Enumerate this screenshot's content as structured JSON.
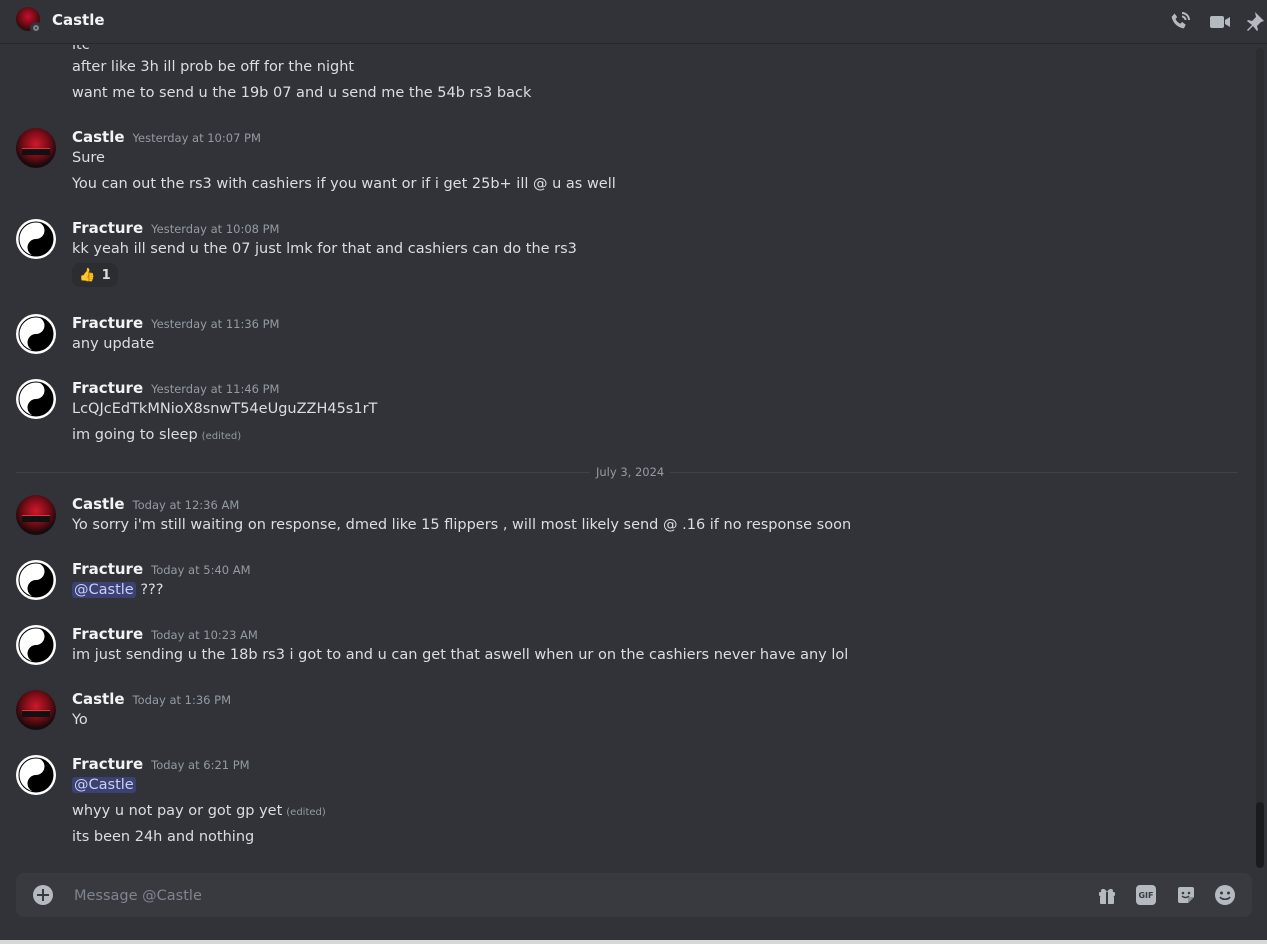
{
  "header": {
    "title": "Castle"
  },
  "messages_prelude": [
    "ltc",
    "after like 3h ill prob be off for the night",
    "want me to send u the 19b 07 and u send me the 54b rs3 back"
  ],
  "groups": [
    {
      "author": "Castle",
      "time": "Yesterday at 10:07 PM",
      "lines": [
        "Sure",
        "You can out the rs3 with cashiers if you want or if i get 25b+ ill @ u as well"
      ]
    },
    {
      "author": "Fracture",
      "time": "Yesterday at 10:08 PM",
      "lines": [
        "kk yeah ill send u the 07 just lmk for that and cashiers can do the rs3"
      ],
      "reaction": {
        "emoji": "👍",
        "count": "1"
      }
    },
    {
      "author": "Fracture",
      "time": "Yesterday at 11:36 PM",
      "lines": [
        "any update"
      ]
    },
    {
      "author": "Fracture",
      "time": "Yesterday at 11:46 PM",
      "lines": [
        "LcQJcEdTkMNioX8snwT54eUguZZH45s1rT",
        "im going to sleep"
      ],
      "edited": "(edited)"
    },
    {
      "author": "Castle",
      "time": "Today at 12:36 AM",
      "lines": [
        "Yo sorry i'm still waiting on response, dmed like 15 flippers , will most likely send @ .16 if no response soon"
      ]
    },
    {
      "author": "Fracture",
      "time": "Today at 5:40 AM",
      "mention": "@Castle",
      "lines": [
        "???"
      ]
    },
    {
      "author": "Fracture",
      "time": "Today at 10:23 AM",
      "lines": [
        "im just sending u the 18b rs3 i got to and u can get that aswell when ur on the cashiers never have any lol"
      ]
    },
    {
      "author": "Castle",
      "time": "Today at 1:36 PM",
      "lines": [
        "Yo"
      ]
    },
    {
      "author": "Fracture",
      "time": "Today at 6:21 PM",
      "mention": "@Castle",
      "lines": [
        "whyy u not pay or got gp yet",
        "its been 24h and nothing"
      ],
      "edited": "(edited)"
    }
  ],
  "divider": {
    "label": "July 3, 2024"
  },
  "composer": {
    "placeholder": "Message @Castle"
  },
  "icons": {
    "header": [
      "phone-call-icon",
      "video-call-icon",
      "pin-icon"
    ],
    "composer": [
      "add-attachment-icon",
      "gift-icon",
      "gif-icon",
      "sticker-icon",
      "emoji-icon"
    ]
  },
  "colors": {
    "background": "#313338",
    "composer": "#383a40",
    "mention": "#3c4270",
    "muted": "#949ba4"
  }
}
